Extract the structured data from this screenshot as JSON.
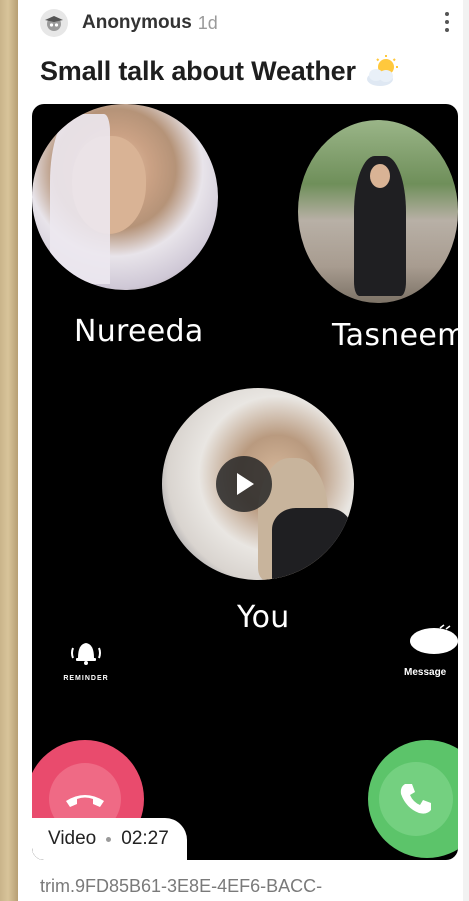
{
  "post": {
    "author": "Anonymous",
    "age": "1d",
    "title": "Small talk about Weather",
    "title_icon": "sun-behind-cloud-icon",
    "avatar_icon": "anonymous-avatar-icon"
  },
  "video": {
    "participants": [
      {
        "name": "Nureeda"
      },
      {
        "name": "Tasneem"
      },
      {
        "name": "You"
      }
    ],
    "reminder_label": "REMINDER",
    "message_label": "Message",
    "badge": {
      "type": "Video",
      "duration": "02:27"
    },
    "colors": {
      "decline": "#e94b6d",
      "accept": "#5cc46a",
      "background": "#000000"
    }
  },
  "attachment": {
    "file_name": "trim.9FD85B61-3E8E-4EF6-BACC-"
  }
}
